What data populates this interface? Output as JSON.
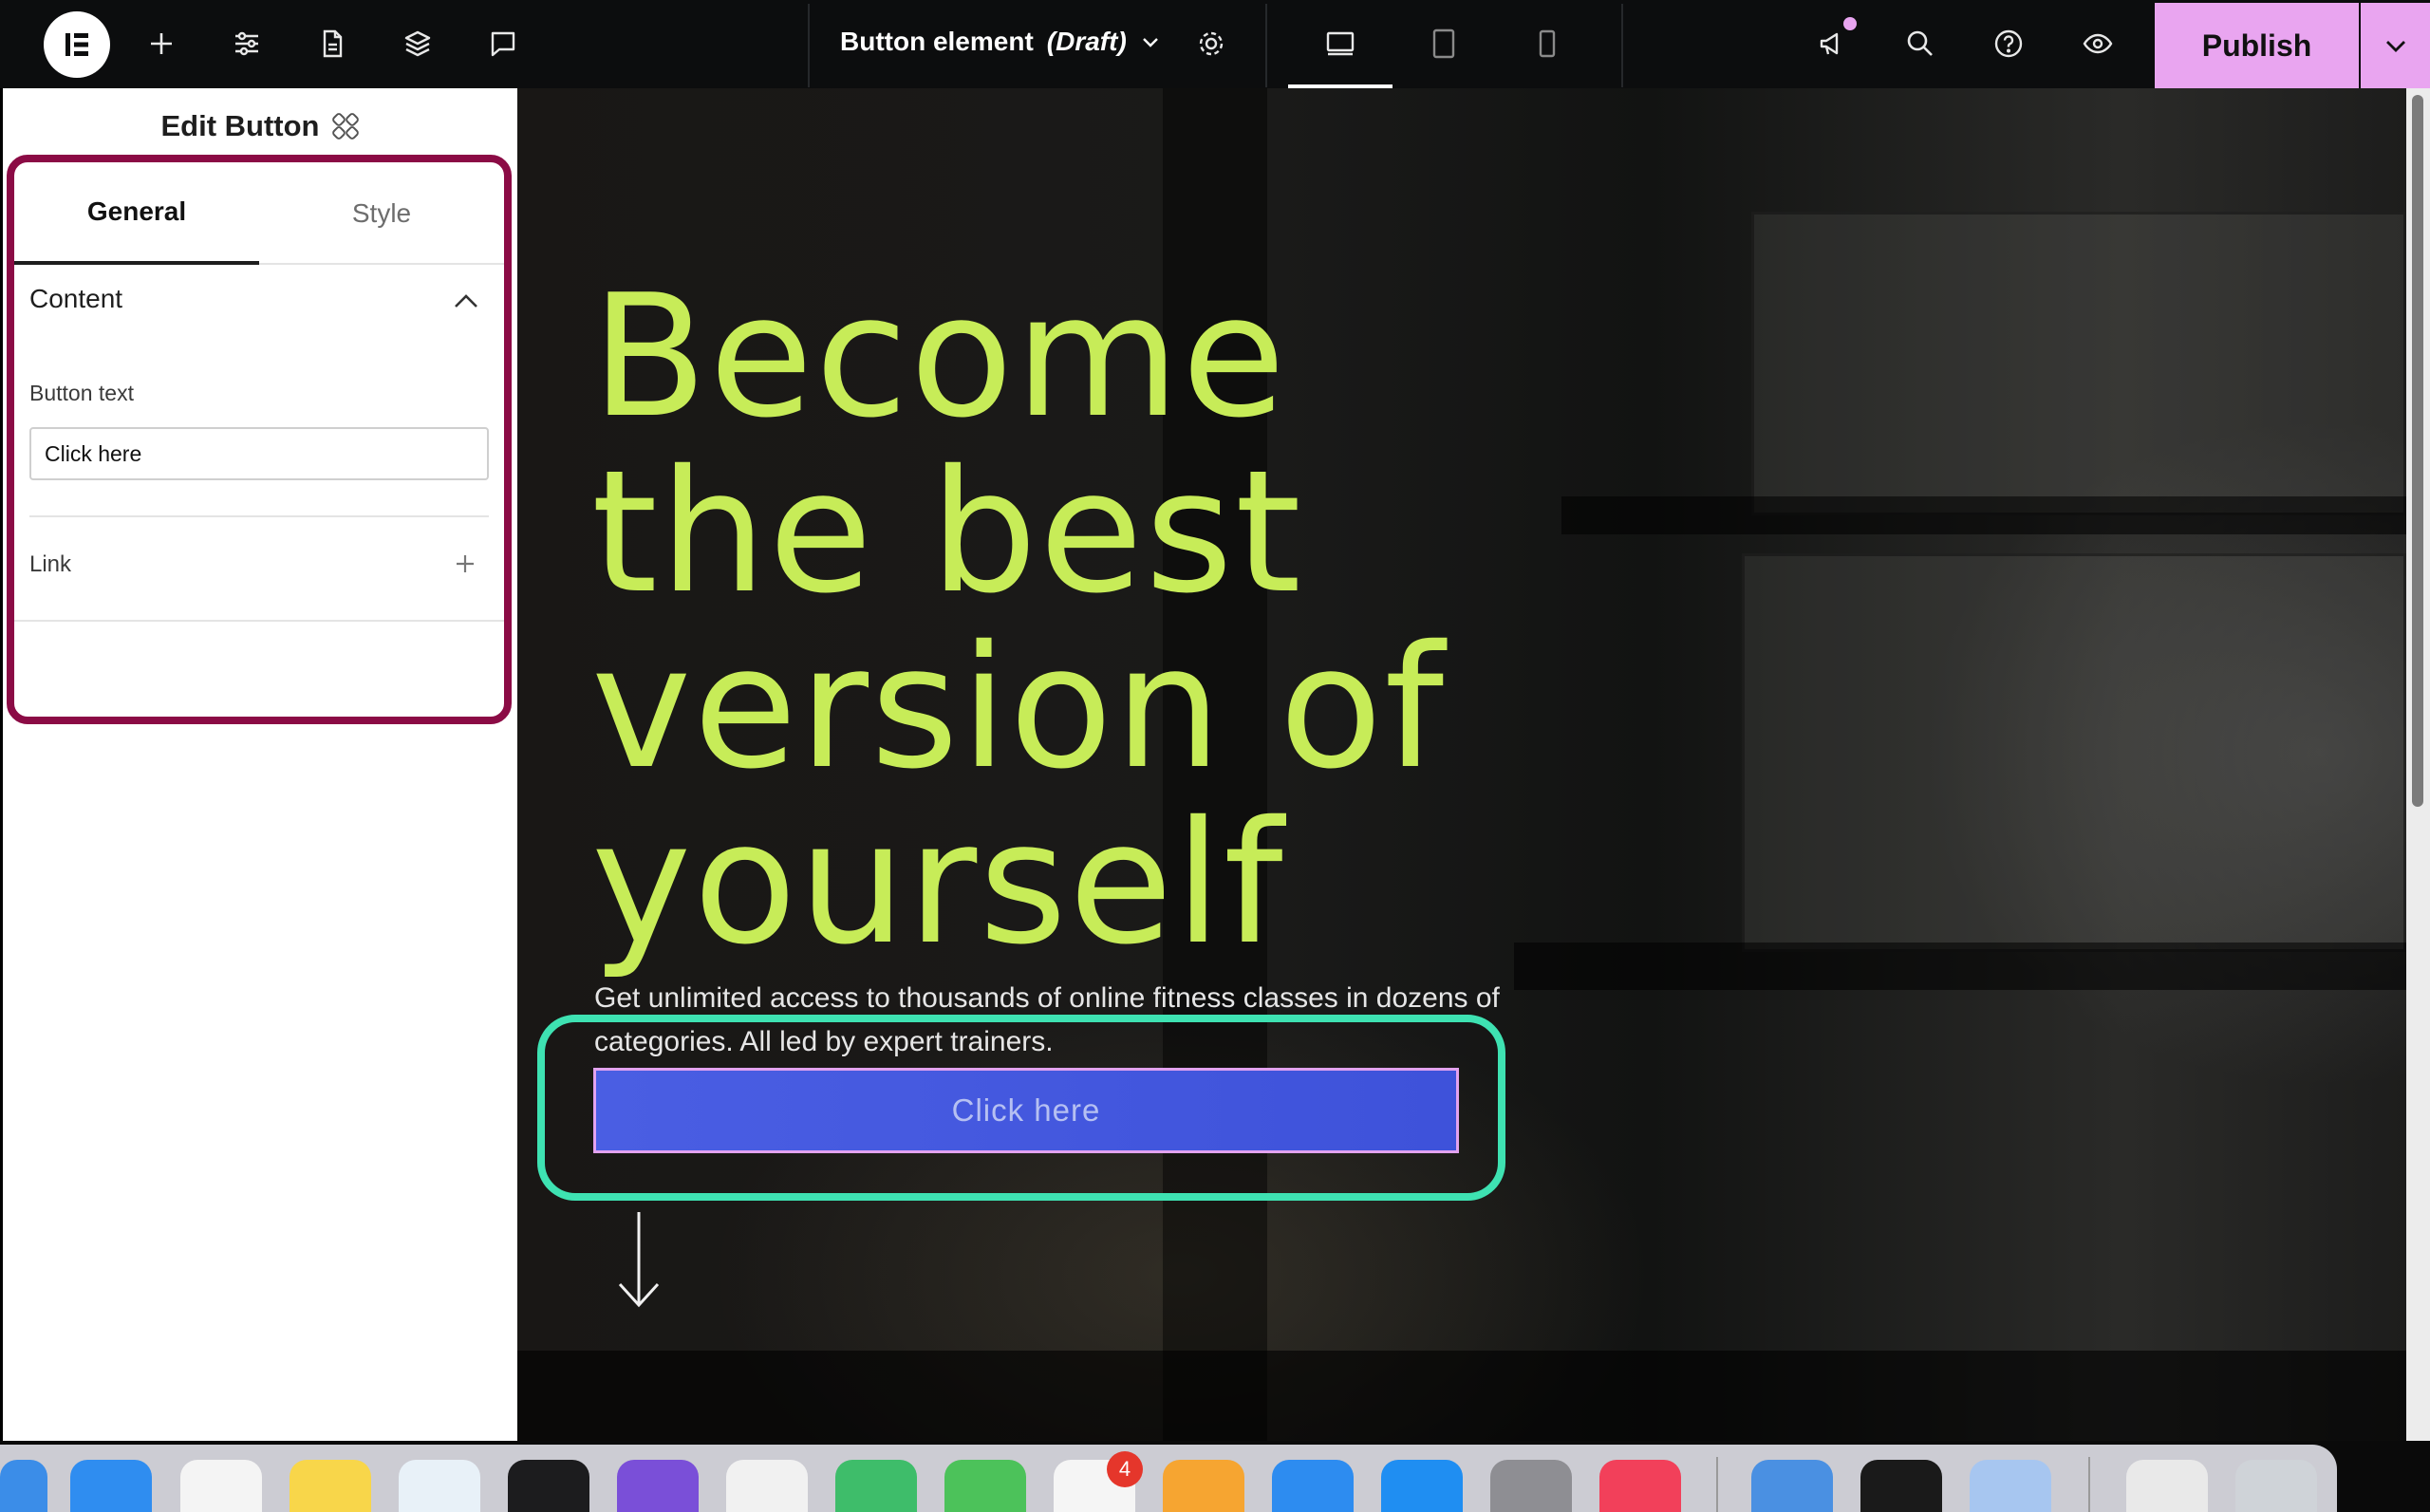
{
  "topbar": {
    "document_title": "Button element",
    "document_status": "(Draft)",
    "publish_label": "Publish"
  },
  "panel": {
    "title": "Edit Button",
    "tabs": [
      {
        "label": "General",
        "active": true
      },
      {
        "label": "Style",
        "active": false
      }
    ],
    "section_title": "Content",
    "button_text_label": "Button text",
    "button_text_value": "Click here",
    "link_label": "Link"
  },
  "canvas": {
    "headline_lines": [
      "Become",
      "the best",
      "version of",
      "yourself"
    ],
    "subtext": "Get unlimited access to thousands of online fitness classes in dozens of categories. All led by expert trainers.",
    "cta_label": "Click here"
  },
  "colors": {
    "headline": "#c7ec58",
    "cta_background": "#4a5ee3",
    "publish_background": "#e9a5f0",
    "panel_highlight": "#8b0b45",
    "button_highlight": "#3ee2b2"
  },
  "dock": {
    "slack_badge": "4"
  }
}
